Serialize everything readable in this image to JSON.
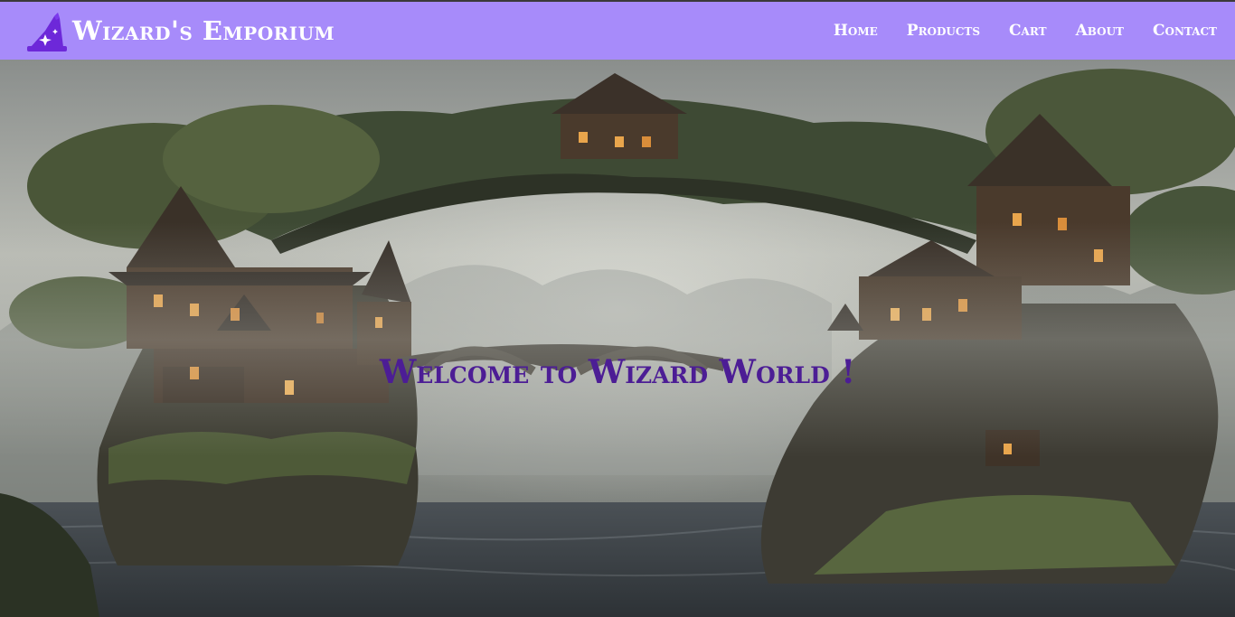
{
  "header": {
    "brand_name": "Wizard's Emporium",
    "brand_icon": "wizard-hat-icon",
    "nav": [
      {
        "label": "Home"
      },
      {
        "label": "Products"
      },
      {
        "label": "Cart"
      },
      {
        "label": "About"
      },
      {
        "label": "Contact"
      }
    ]
  },
  "hero": {
    "title": "Welcome to Wizard World !",
    "image_subject": "fantasy-treehouse-village-bridge"
  },
  "colors": {
    "navbar": "#a78bfa",
    "nav_text": "#ffffff",
    "hero_title": "#4c1d95",
    "icon": "#6d28d9"
  }
}
